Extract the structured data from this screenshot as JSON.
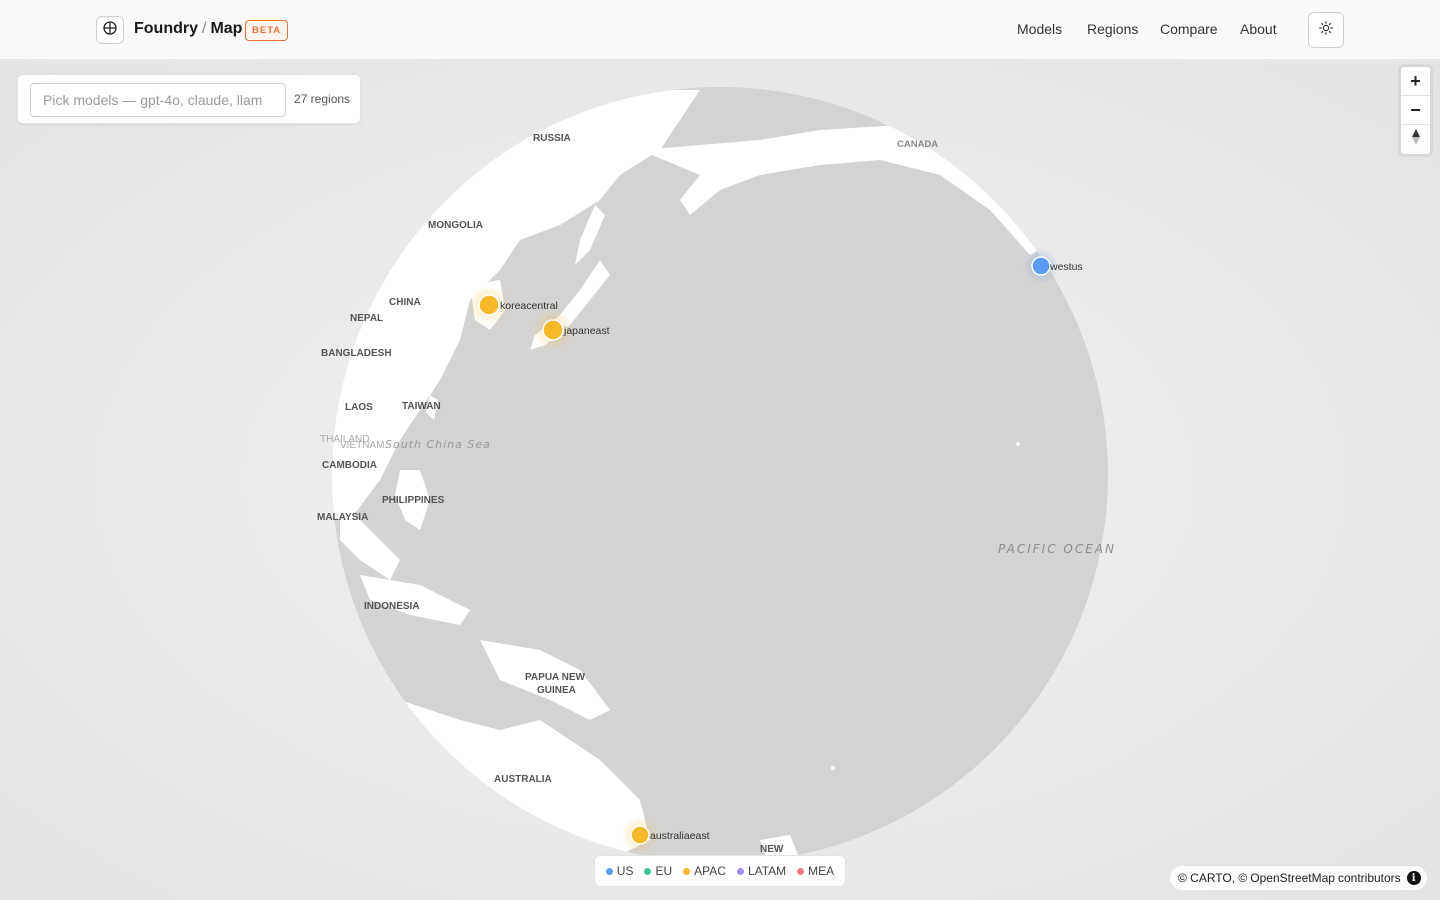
{
  "header": {
    "brand_main": "Foundry",
    "brand_sep": "/",
    "brand_sub": "Map",
    "badge": "BETA",
    "nav": [
      "Models",
      "Regions",
      "Compare",
      "About"
    ]
  },
  "search": {
    "placeholder": "Pick models — gpt-4o, claude, llam",
    "count": "27 regions"
  },
  "zoom": {
    "in": "+",
    "out": "−"
  },
  "map_labels": {
    "russia": "RUSSIA",
    "canada": "CANADA",
    "mongolia": "MONGOLIA",
    "china": "CHINA",
    "nepal": "NEPAL",
    "bangladesh": "BANGLADESH",
    "laos": "LAOS",
    "taiwan": "TAIWAN",
    "thailand": "THAILAND",
    "vietnam": "VIETNAM",
    "cambodia": "CAMBODIA",
    "philippines": "PHILIPPINES",
    "malaysia": "MALAYSIA",
    "indonesia": "INDONESIA",
    "png1": "PAPUA NEW",
    "png2": "GUINEA",
    "australia": "AUSTRALIA",
    "newzealand": "NEW",
    "south_china_sea": "South China Sea",
    "pacific": "PACIFIC OCEAN"
  },
  "markers": [
    {
      "name": "westus",
      "group": "US"
    },
    {
      "name": "koreacentral",
      "group": "APAC"
    },
    {
      "name": "japaneast",
      "group": "APAC"
    },
    {
      "name": "australiaeast",
      "group": "APAC"
    }
  ],
  "legend": [
    {
      "label": "US",
      "color": "#5b9bf0"
    },
    {
      "label": "EU",
      "color": "#3cc39a"
    },
    {
      "label": "APAC",
      "color": "#f5b92a"
    },
    {
      "label": "LATAM",
      "color": "#a38cf0"
    },
    {
      "label": "MEA",
      "color": "#f07a85"
    }
  ],
  "attribution": {
    "carto": "© CARTO, ©",
    "osm": "OpenStreetMap",
    "contrib": "contributors"
  },
  "colors": {
    "us": "#5b9bf0",
    "apac": "#f5b92a",
    "accent": "#e8733c",
    "ocean": "#d5d3d1",
    "land": "#ffffff"
  }
}
